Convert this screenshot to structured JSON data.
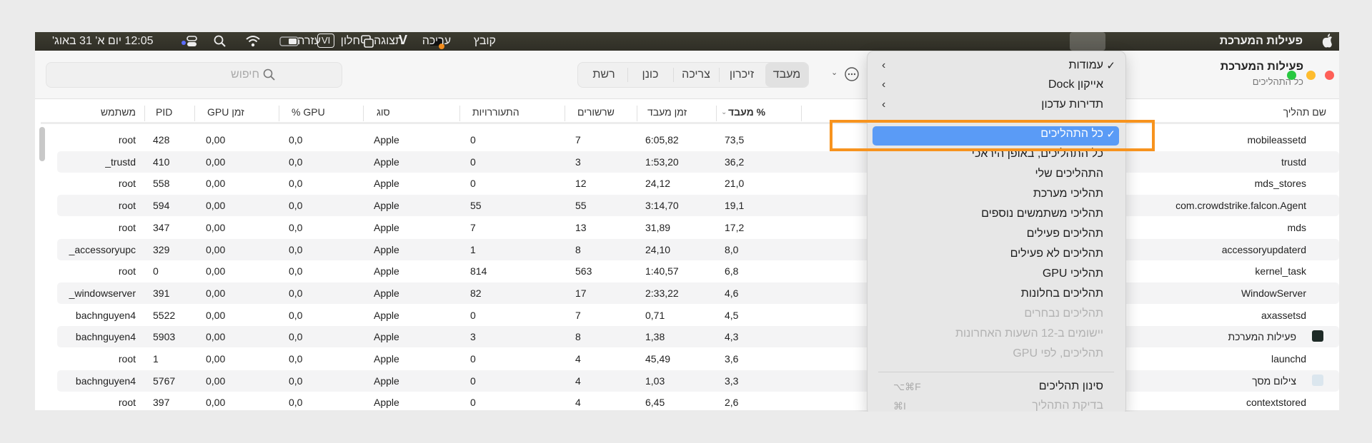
{
  "menubar": {
    "clock": "12:05 יום א' 31 באוג'",
    "app_name": "פעילות המערכת",
    "menus": [
      "קובץ",
      "עריכה",
      "תצוגה",
      "חלון",
      "עזרה"
    ],
    "active_menu": "תצוגה",
    "status_icons": [
      "control-center-icon",
      "search-icon",
      "wifi-icon",
      "battery-icon",
      "input-source-vi-icon",
      "window-icon",
      "v-app-icon",
      "cloud-icon"
    ],
    "vi_label": "VI",
    "v_label": "V"
  },
  "window": {
    "title": "פעילות המערכת",
    "subtitle": "כל התהליכים",
    "traffic_colors": {
      "close": "#fe5f57",
      "minimize": "#febc2e",
      "zoom": "#28c840"
    }
  },
  "toolbar": {
    "search_placeholder": "חיפוש",
    "tabs": [
      "מעבד",
      "זיכרון",
      "צריכה",
      "כונן",
      "רשת"
    ],
    "selected_tab": "מעבד"
  },
  "table": {
    "headers": {
      "name": "שם תהליך",
      "cpu_pct": "% מעבד",
      "cpu_time": "זמן מעבד",
      "threads": "שרשורים",
      "wakeups": "התעוררויות",
      "kind": "סוג",
      "gpu_pct": "% GPU",
      "gpu_time": "זמן GPU",
      "pid": "PID",
      "user": "משתמש"
    },
    "rows": [
      {
        "name": "mobileassetd",
        "cpu_pct": "73,5",
        "cpu_time": "6:05,82",
        "threads": "7",
        "wakeups": "0",
        "kind": "Apple",
        "gpu_pct": "0,0",
        "gpu_time": "0,00",
        "pid": "428",
        "user": "root"
      },
      {
        "name": "trustd",
        "cpu_pct": "36,2",
        "cpu_time": "1:53,20",
        "threads": "3",
        "wakeups": "0",
        "kind": "Apple",
        "gpu_pct": "0,0",
        "gpu_time": "0,00",
        "pid": "410",
        "user": "_trustd"
      },
      {
        "name": "mds_stores",
        "cpu_pct": "21,0",
        "cpu_time": "24,12",
        "threads": "12",
        "wakeups": "0",
        "kind": "Apple",
        "gpu_pct": "0,0",
        "gpu_time": "0,00",
        "pid": "558",
        "user": "root"
      },
      {
        "name": "com.crowdstrike.falcon.Agent",
        "cpu_pct": "19,1",
        "cpu_time": "3:14,70",
        "threads": "55",
        "wakeups": "55",
        "kind": "Apple",
        "gpu_pct": "0,0",
        "gpu_time": "0,00",
        "pid": "594",
        "user": "root"
      },
      {
        "name": "mds",
        "cpu_pct": "17,2",
        "cpu_time": "31,89",
        "threads": "13",
        "wakeups": "7",
        "kind": "Apple",
        "gpu_pct": "0,0",
        "gpu_time": "0,00",
        "pid": "347",
        "user": "root"
      },
      {
        "name": "accessoryupdaterd",
        "cpu_pct": "8,0",
        "cpu_time": "24,10",
        "threads": "8",
        "wakeups": "1",
        "kind": "Apple",
        "gpu_pct": "0,0",
        "gpu_time": "0,00",
        "pid": "329",
        "user": "_accessoryupc"
      },
      {
        "name": "kernel_task",
        "cpu_pct": "6,8",
        "cpu_time": "1:40,57",
        "threads": "563",
        "wakeups": "814",
        "kind": "Apple",
        "gpu_pct": "0,0",
        "gpu_time": "0,00",
        "pid": "0",
        "user": "root"
      },
      {
        "name": "WindowServer",
        "cpu_pct": "4,6",
        "cpu_time": "2:33,22",
        "threads": "17",
        "wakeups": "82",
        "kind": "Apple",
        "gpu_pct": "0,0",
        "gpu_time": "0,00",
        "pid": "391",
        "user": "_windowserver"
      },
      {
        "name": "axassetsd",
        "cpu_pct": "4,5",
        "cpu_time": "0,71",
        "threads": "7",
        "wakeups": "0",
        "kind": "Apple",
        "gpu_pct": "0,0",
        "gpu_time": "0,00",
        "pid": "5522",
        "user": "bachnguyen4"
      },
      {
        "name": "פעילות המערכת",
        "icon": "activity-monitor-icon",
        "cpu_pct": "4,3",
        "cpu_time": "1,38",
        "threads": "8",
        "wakeups": "3",
        "kind": "Apple",
        "gpu_pct": "0,0",
        "gpu_time": "0,00",
        "pid": "5903",
        "user": "bachnguyen4"
      },
      {
        "name": "launchd",
        "cpu_pct": "3,6",
        "cpu_time": "45,49",
        "threads": "4",
        "wakeups": "0",
        "kind": "Apple",
        "gpu_pct": "0,0",
        "gpu_time": "0,00",
        "pid": "1",
        "user": "root"
      },
      {
        "name": "צילום מסך",
        "icon": "screenshot-icon",
        "cpu_pct": "3,3",
        "cpu_time": "1,03",
        "threads": "4",
        "wakeups": "0",
        "kind": "Apple",
        "gpu_pct": "0,0",
        "gpu_time": "0,00",
        "pid": "5767",
        "user": "bachnguyen4"
      },
      {
        "name": "contextstored",
        "cpu_pct": "2,6",
        "cpu_time": "6,45",
        "threads": "4",
        "wakeups": "0",
        "kind": "Apple",
        "gpu_pct": "0,0",
        "gpu_time": "0,00",
        "pid": "397",
        "user": "root"
      }
    ]
  },
  "view_menu": {
    "submenus": [
      {
        "label": "עמודות",
        "checked": true
      },
      {
        "label": "אייקון Dock",
        "checked": false
      },
      {
        "label": "תדירות עדכון",
        "checked": false
      }
    ],
    "filters": [
      {
        "label": "כל התהליכים",
        "checked": true,
        "highlighted": true,
        "disabled": false
      },
      {
        "label": "כל התהליכים, באופן היראכי",
        "disabled": false
      },
      {
        "label": "התהליכים שלי",
        "disabled": false
      },
      {
        "label": "תהליכי מערכת",
        "disabled": false
      },
      {
        "label": "תהליכי משתמשים נוספים",
        "disabled": false
      },
      {
        "label": "תהליכים פעילים",
        "disabled": false
      },
      {
        "label": "תהליכים לא פעילים",
        "disabled": false
      },
      {
        "label": "תהליכי GPU",
        "disabled": false
      },
      {
        "label": "תהליכים בחלונות",
        "disabled": false
      },
      {
        "label": "תהליכים נבחרים",
        "disabled": true
      },
      {
        "label": "יישומים ב-12 השעות האחרונות",
        "disabled": true
      },
      {
        "label": "תהליכים, לפי GPU",
        "disabled": true
      }
    ],
    "actions": [
      {
        "label": "סינון תהליכים",
        "shortcut": "⌥⌘F",
        "disabled": false
      },
      {
        "label": "בדיקת התהליך",
        "shortcut": "⌘I",
        "disabled": true
      }
    ],
    "check_glyph": "✓",
    "highlight_color": "#5a9bf6",
    "annotation_color": "#f7931e"
  }
}
